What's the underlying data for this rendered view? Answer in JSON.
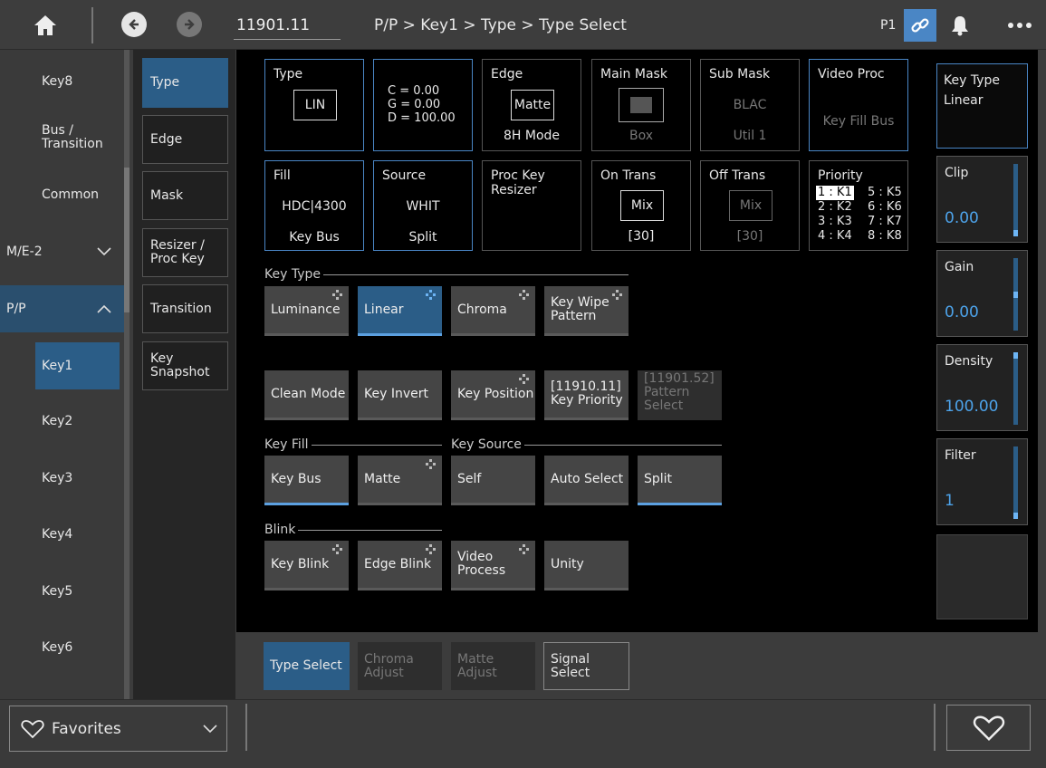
{
  "topbar": {
    "number_field": "11901.11",
    "breadcrumb": "P/P > Key1 > Type > Type Select",
    "panel_label": "P1",
    "icons": {
      "home": "home-icon",
      "back": "arrow-left-icon",
      "forward": "arrow-right-icon",
      "link": "link-icon",
      "bell": "bell-icon",
      "more": "more-icon"
    }
  },
  "leftnav": {
    "items": [
      {
        "label": "Key8"
      },
      {
        "label": "Bus /\nTransition"
      },
      {
        "label": "Common"
      },
      {
        "label": "M/E-2"
      },
      {
        "label": "P/P"
      },
      {
        "label": "Key1"
      },
      {
        "label": "Key2"
      },
      {
        "label": "Key3"
      },
      {
        "label": "Key4"
      },
      {
        "label": "Key5"
      },
      {
        "label": "Key6"
      }
    ]
  },
  "subnav": {
    "items": [
      "Type",
      "Edge",
      "Mask",
      "Resizer /\nProc Key",
      "Transition",
      "Key\nSnapshot"
    ]
  },
  "summary": {
    "type": {
      "title": "Type",
      "value": "LIN"
    },
    "cgd": {
      "c": "C   = 0.00",
      "g": "G   = 0.00",
      "d": "D   = 100.00"
    },
    "edge": {
      "title": "Edge",
      "value": "Matte",
      "sub": "8H Mode"
    },
    "main_mask": {
      "title": "Main Mask",
      "sub": "Box"
    },
    "sub_mask": {
      "title": "Sub Mask",
      "value": "BLAC",
      "sub": "Util 1"
    },
    "video_proc": {
      "title": "Video Proc",
      "value": "Key Fill Bus"
    },
    "fill": {
      "title": "Fill",
      "value": "HDC|4300",
      "sub": "Key Bus"
    },
    "source": {
      "title": "Source",
      "value": "WHIT",
      "sub": "Split"
    },
    "proc_key": {
      "title": "Proc Key\nResizer"
    },
    "on_trans": {
      "title": "On Trans",
      "value": "Mix",
      "sub": "[30]"
    },
    "off_trans": {
      "title": "Off Trans",
      "value": "Mix",
      "sub": "[30]"
    },
    "priority": {
      "title": "Priority",
      "left": [
        "1 : K1",
        "2 : K2",
        "3 : K3",
        "4 : K4"
      ],
      "right": [
        "5 : K5",
        "6 : K6",
        "7 : K7",
        "8 : K8"
      ]
    }
  },
  "sections": {
    "key_type": "Key Type",
    "key_fill": "Key Fill",
    "key_source": "Key Source",
    "blink": "Blink"
  },
  "buttons": {
    "luminance": "Luminance",
    "linear": "Linear",
    "chroma": "Chroma",
    "key_wipe": "Key Wipe\nPattern",
    "clean_mode": "Clean Mode",
    "key_invert": "Key Invert",
    "key_position": "Key Position",
    "key_priority_num": "[11910.11]",
    "key_priority": "Key Priority",
    "pattern_select_num": "[11901.52]",
    "pattern_select": "Pattern\nSelect",
    "key_bus": "Key Bus",
    "matte": "Matte",
    "self": "Self",
    "auto_select": "Auto Select",
    "split": "Split",
    "key_blink": "Key Blink",
    "edge_blink": "Edge Blink",
    "video_process": "Video\nProcess",
    "unity": "Unity"
  },
  "right": {
    "key_type": {
      "title": "Key Type",
      "value": "Linear"
    },
    "clip": {
      "title": "Clip",
      "value": "0.00",
      "level": 0.0
    },
    "gain": {
      "title": "Gain",
      "value": "0.00",
      "level": 0.5
    },
    "density": {
      "title": "Density",
      "value": "100.00",
      "level": 1.0
    },
    "filter": {
      "title": "Filter",
      "value": "1",
      "level": 0.0
    }
  },
  "bottom_tabs": [
    "Type Select",
    "Chroma\nAdjust",
    "Matte Adjust",
    "Signal Select"
  ],
  "footer": {
    "favorites": "Favorites",
    "icons": {
      "heart": "heart-icon",
      "chevron": "chevron-down-icon"
    }
  },
  "colors": {
    "accent": "#2b5d87",
    "accent_light": "#4da3ea",
    "background": "#3c3c3c"
  }
}
